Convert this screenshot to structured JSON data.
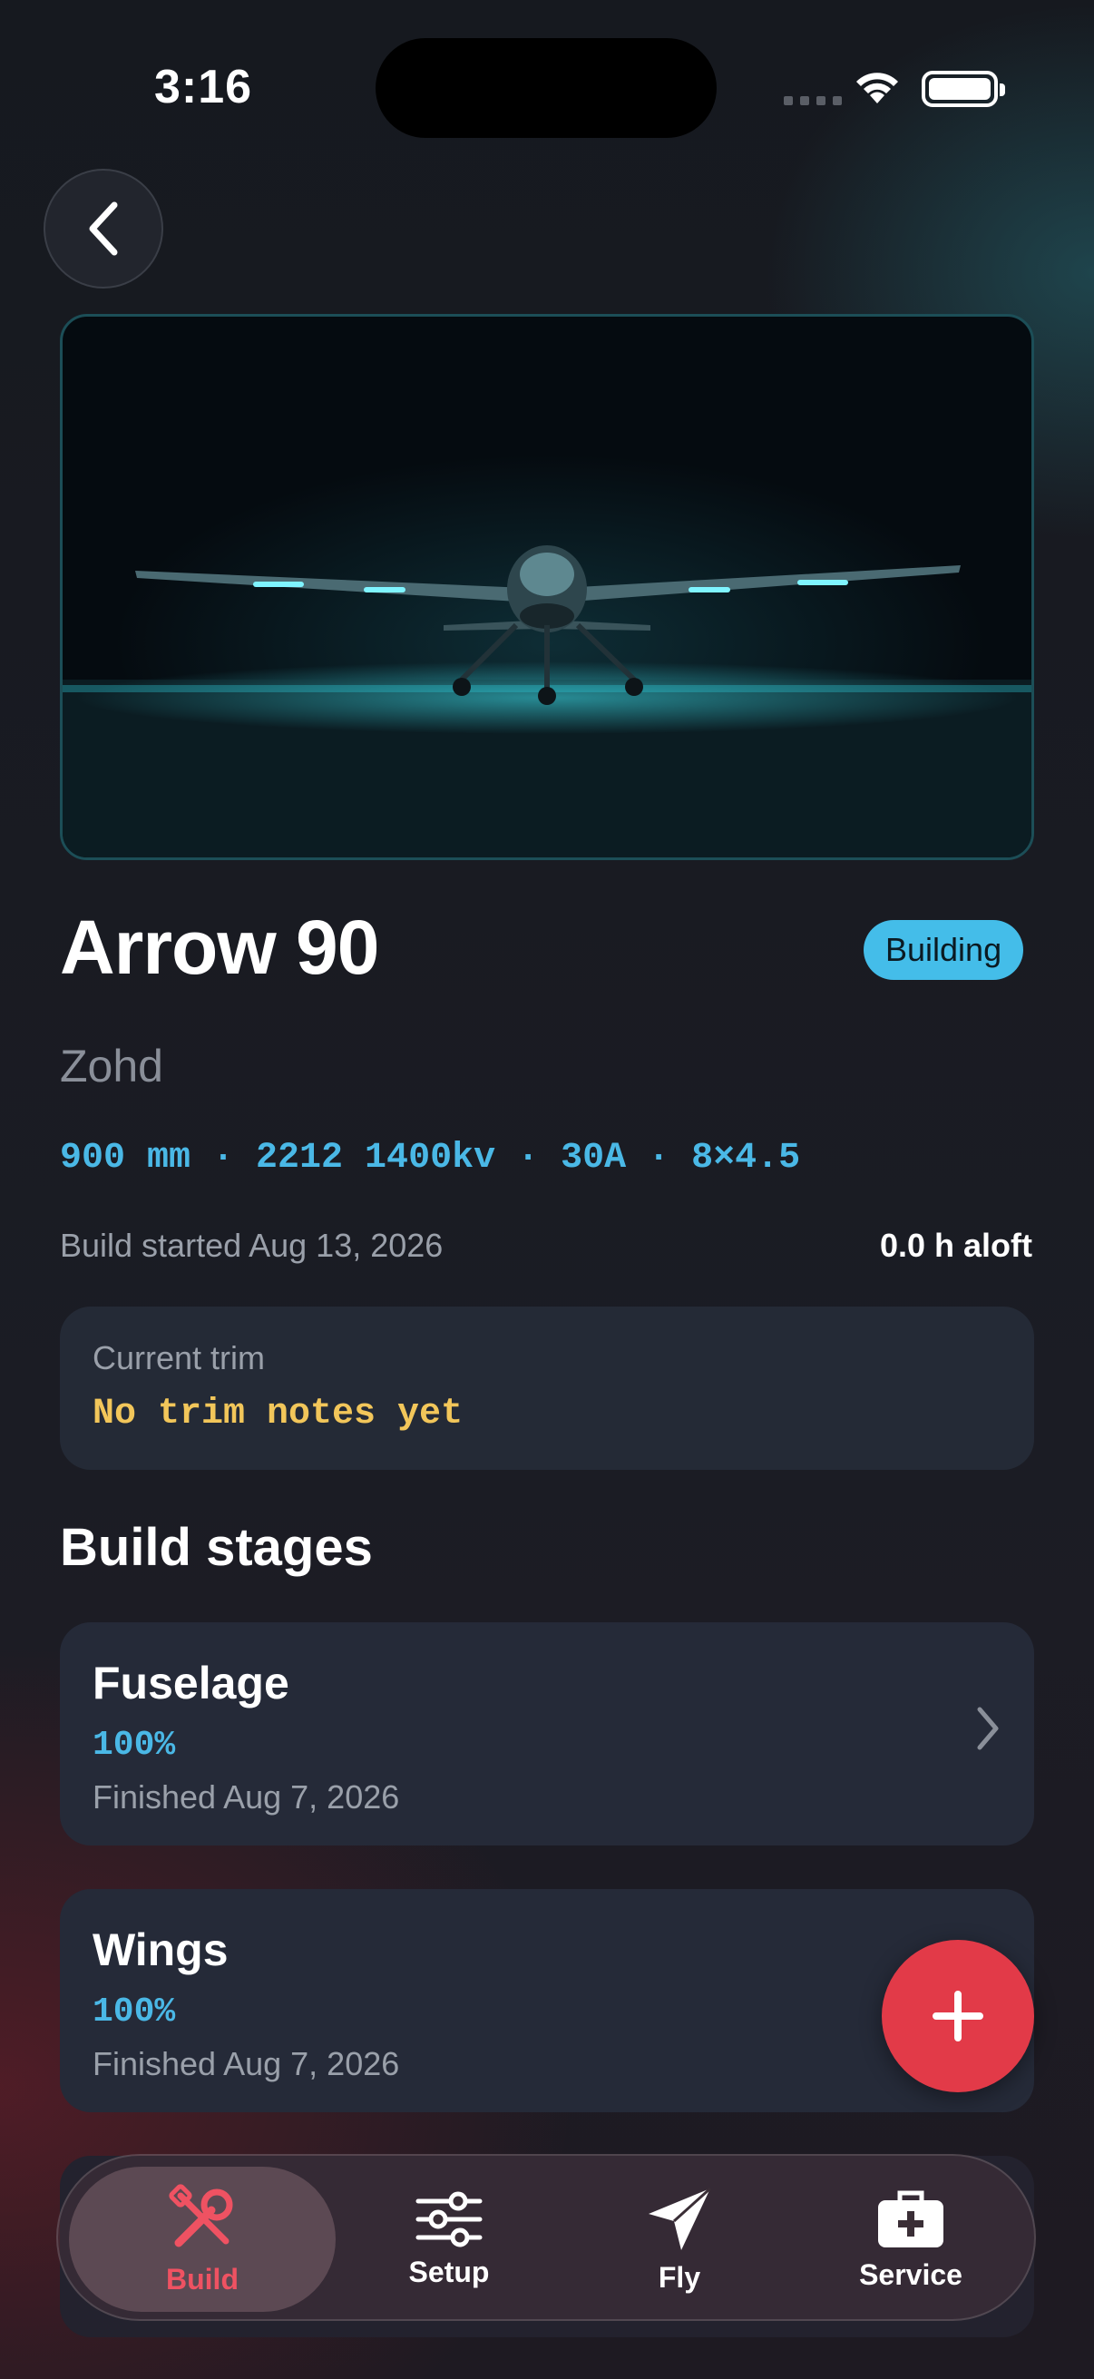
{
  "status_bar": {
    "time": "3:16"
  },
  "aircraft": {
    "name": "Arrow 90",
    "status_badge": "Building",
    "maker": "Zohd",
    "specs": "900 mm · 2212 1400kv · 30A · 8×4.5",
    "build_started": "Build started Aug 13, 2026",
    "hours_aloft": "0.0 h aloft"
  },
  "trim": {
    "label": "Current trim",
    "value": "No trim notes yet"
  },
  "build_stages": {
    "title": "Build stages",
    "items": [
      {
        "name": "Fuselage",
        "percent": "100%",
        "date": "Finished Aug 7, 2026"
      },
      {
        "name": "Wings",
        "percent": "100%",
        "date": "Finished Aug 7, 2026"
      }
    ]
  },
  "tabs": [
    {
      "label": "Build",
      "icon": "wrench-screwdriver-icon",
      "active": true
    },
    {
      "label": "Setup",
      "icon": "sliders-icon",
      "active": false
    },
    {
      "label": "Fly",
      "icon": "paper-plane-icon",
      "active": false
    },
    {
      "label": "Service",
      "icon": "medical-kit-icon",
      "active": false
    }
  ],
  "colors": {
    "accent_blue": "#44bde9",
    "accent_red": "#e23a48",
    "trim_yellow": "#f2c65a"
  }
}
